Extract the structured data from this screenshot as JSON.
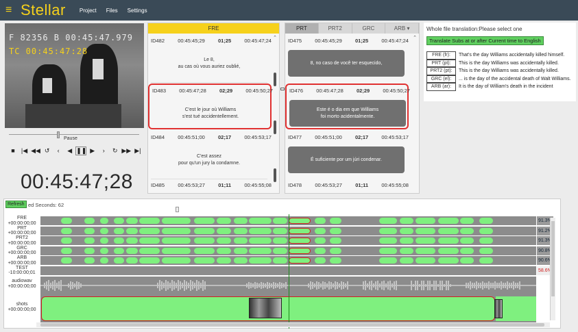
{
  "app": {
    "brand": "Stellar",
    "menu": [
      "Project",
      "Files",
      "Settings"
    ]
  },
  "video": {
    "timecode_top": "F 82356 B 00:45:47.979",
    "timecode_bottom": "TC 00:45:47:28",
    "status": "Pause",
    "big_time": "00:45:47;28",
    "controls": [
      "stop",
      "skip-start",
      "rewind-fast",
      "replay",
      "step-back",
      "play-reverse",
      "pause",
      "play",
      "step-forward",
      "forward",
      "fast-forward",
      "skip-end"
    ]
  },
  "fre_panel": {
    "tab": "FRE",
    "entries": [
      {
        "id": "ID482",
        "start": "00:45:45;29",
        "dur": "01;25",
        "end": "00:45:47;24",
        "text": [
          "Le 8,",
          "au cas où vous auriez oublié,"
        ]
      },
      {
        "id": "ID483",
        "start": "00:45:47;28",
        "dur": "02;29",
        "end": "00:45:50;27",
        "text": [
          "C'est le jour où Williams",
          "s'est tué accidentellement."
        ]
      },
      {
        "id": "ID484",
        "start": "00:45:51;00",
        "dur": "02;17",
        "end": "00:45:53;17",
        "text": [
          "C'est assez",
          "pour qu'un jury la condamne."
        ]
      },
      {
        "id": "ID485",
        "start": "00:45:53;27",
        "dur": "01;11",
        "end": "00:45:55;08",
        "text": []
      }
    ]
  },
  "prt_panel": {
    "tabs": [
      "PRT",
      "PRT2",
      "GRC",
      "ARB ▾"
    ],
    "entries": [
      {
        "id": "ID475",
        "start": "00:45:45;29",
        "dur": "01;25",
        "end": "00:45:47;24",
        "text": [
          "8, no caso de você ter esquecido,"
        ]
      },
      {
        "id": "ID476",
        "start": "00:45:47;28",
        "dur": "02;29",
        "end": "00:45:50;27",
        "text": [
          "Este é o dia em que Williams",
          "foi morto acidentalmente."
        ]
      },
      {
        "id": "ID477",
        "start": "00:45:51;00",
        "dur": "02;17",
        "end": "00:45:53;17",
        "text": [
          "É suficiente por um júri condenar."
        ]
      },
      {
        "id": "ID478",
        "start": "00:45:53;27",
        "dur": "01;11",
        "end": "00:45:55;08",
        "text": []
      }
    ]
  },
  "translation": {
    "title": "Whole file translation:Please select one",
    "button": "Translate Subs at or after Current time to English",
    "rows": [
      {
        "lang": "FRE (fr):",
        "text": "That's the day Williams accidentally killed himself."
      },
      {
        "lang": "PRT (pt):",
        "text": "This is the day Williams was accidentally killed."
      },
      {
        "lang": "PRT2 (pt):",
        "text": "This is the day Williams was accidentally killed."
      },
      {
        "lang": "GRC (el):",
        "text": "... is the day of the accidental death of Walt Williams."
      },
      {
        "lang": "ARB (ar):",
        "text": "It is the day of William's death in the incident"
      }
    ]
  },
  "timeline": {
    "refresh": "Refresh",
    "edited_seconds": "ed Seconds: 62",
    "tracks": [
      {
        "name": "FRE",
        "offset": "+00:00:00;00",
        "pct": "91.3%"
      },
      {
        "name": "PRT",
        "offset": "+00:00:00;00",
        "pct": "91.2%"
      },
      {
        "name": "PRT2",
        "offset": "+00:00:00;00",
        "pct": "91.3%"
      },
      {
        "name": "GRC",
        "offset": "+00:00:00;00",
        "pct": "90.8%"
      },
      {
        "name": "ARB",
        "offset": "+00:00:00;00",
        "pct": "90.6%"
      },
      {
        "name": "TEST",
        "offset": "-10:00:00;01",
        "pct": "58.6%"
      }
    ],
    "audio": {
      "name": "audiowav",
      "offset": "+00:00:00;00"
    },
    "shots": {
      "name": "shots",
      "offset": "+00:00:00;00"
    }
  }
}
